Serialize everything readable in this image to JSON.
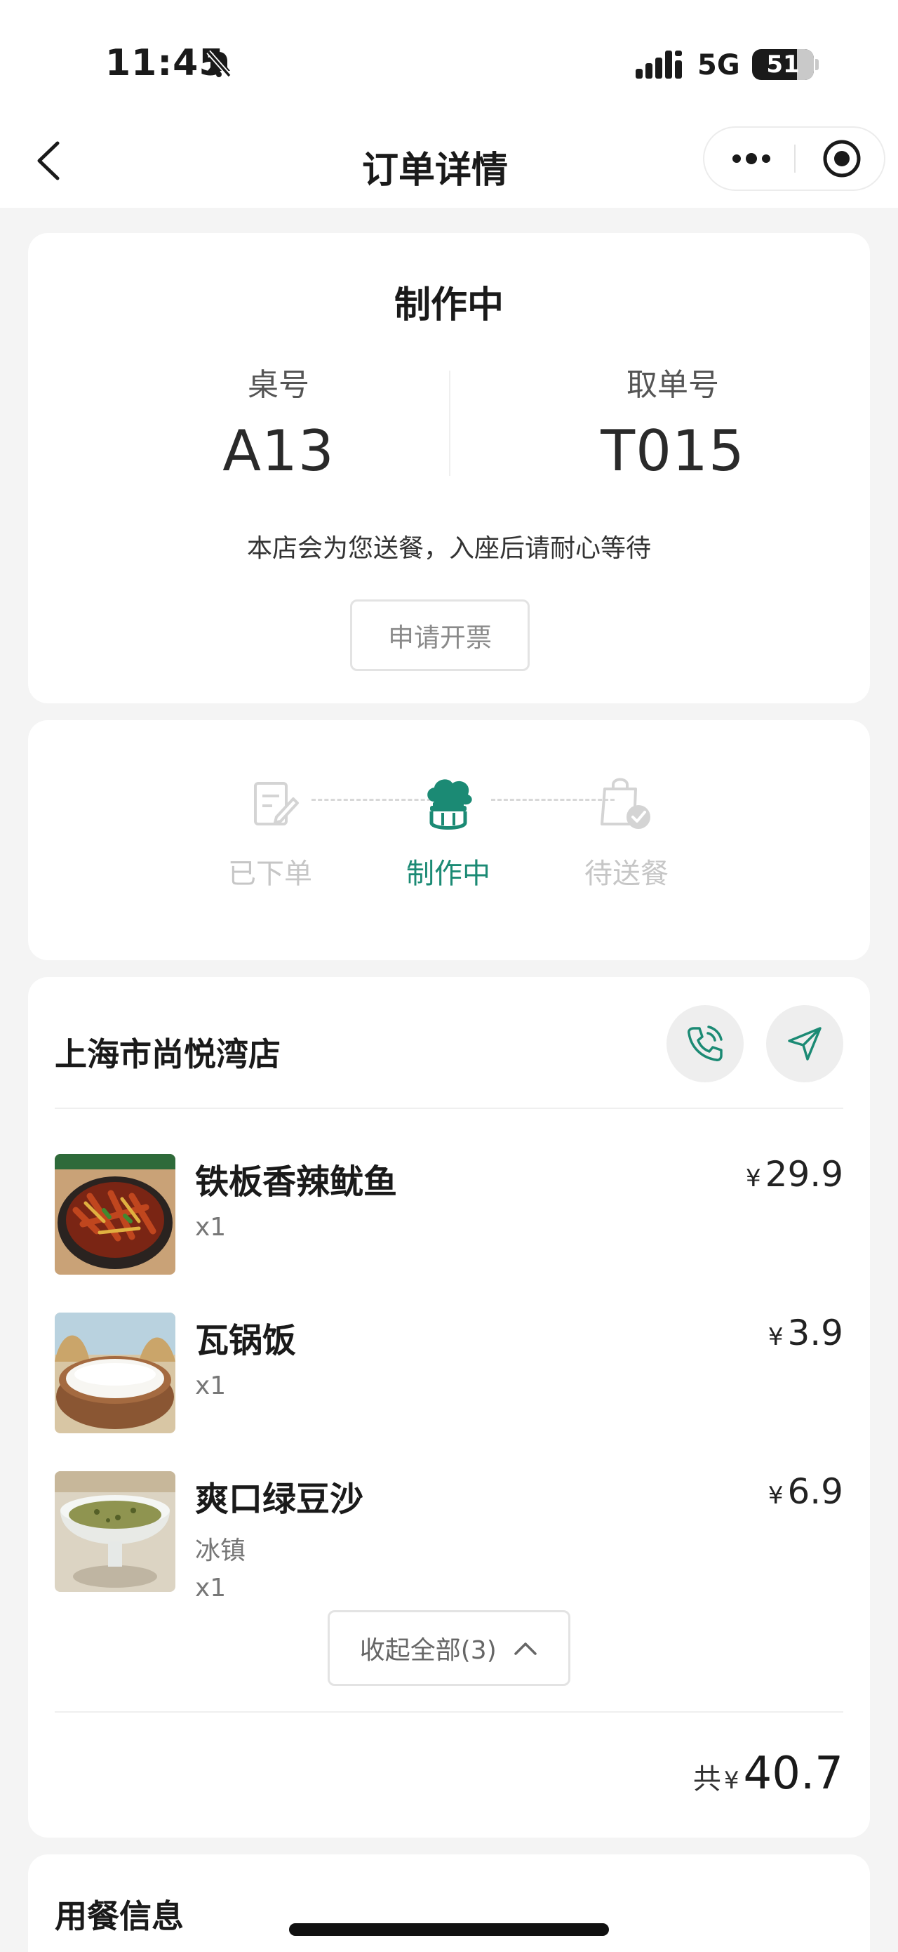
{
  "status_bar": {
    "time": "11:45",
    "network": "5G",
    "battery": "51"
  },
  "nav": {
    "title": "订单详情"
  },
  "order_status": {
    "title": "制作中",
    "table_label": "桌号",
    "table_value": "A13",
    "pickup_label": "取单号",
    "pickup_value": "T015",
    "hint": "本店会为您送餐，入座后请耐心等待",
    "invoice_button": "申请开票"
  },
  "progress": {
    "steps": [
      {
        "label": "已下单",
        "state": "done"
      },
      {
        "label": "制作中",
        "state": "active"
      },
      {
        "label": "待送餐",
        "state": "pending"
      }
    ],
    "active_color": "#1b8a74"
  },
  "store": {
    "name": "上海市尚悦湾店",
    "items": [
      {
        "name": "铁板香辣鱿鱼",
        "qty": "x1",
        "currency": "¥",
        "price": "29.9"
      },
      {
        "name": "瓦锅饭",
        "qty": "x1",
        "currency": "¥",
        "price": "3.9"
      },
      {
        "name": "爽口绿豆沙",
        "spec": "冰镇",
        "qty": "x1",
        "currency": "¥",
        "price": "6.9"
      }
    ],
    "collapse_button": "收起全部(3)",
    "total_prefix": "共",
    "total_currency": "¥",
    "total_amount": "40.7"
  },
  "dining_info": {
    "title": "用餐信息"
  }
}
